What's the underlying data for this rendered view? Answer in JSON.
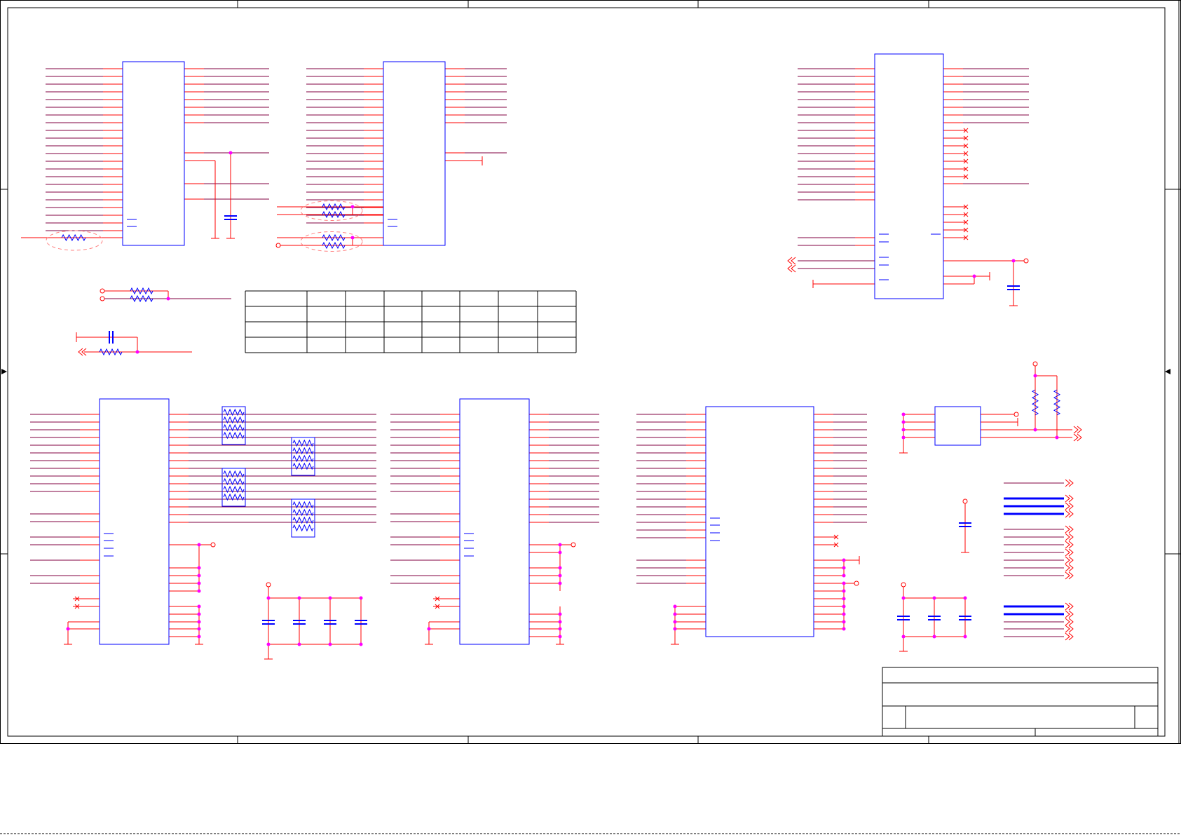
{
  "sheet": {
    "background": "#ffffff",
    "border_color": "#000000",
    "wire_color": "#ff0000",
    "bus_color": "#800040",
    "part_color": "#0000ff",
    "junction_color": "#ff00ff",
    "noconnect_color": "#ff0000",
    "offpage_color": "#ff0000",
    "outline_color": "#ff8080"
  },
  "title_block": {
    "title": "",
    "doc_number": "",
    "rev": "",
    "date": "",
    "sheet": ""
  },
  "parts": [
    {
      "id": "U1",
      "kind": "ic"
    },
    {
      "id": "U2",
      "kind": "ic"
    },
    {
      "id": "U3",
      "kind": "ic"
    },
    {
      "id": "U4",
      "kind": "ic"
    },
    {
      "id": "U5",
      "kind": "ic"
    },
    {
      "id": "U6",
      "kind": "ic"
    },
    {
      "id": "U7",
      "kind": "ic"
    }
  ],
  "resistor_networks": 4,
  "info_table": {
    "rows": 4,
    "cols": 8
  }
}
